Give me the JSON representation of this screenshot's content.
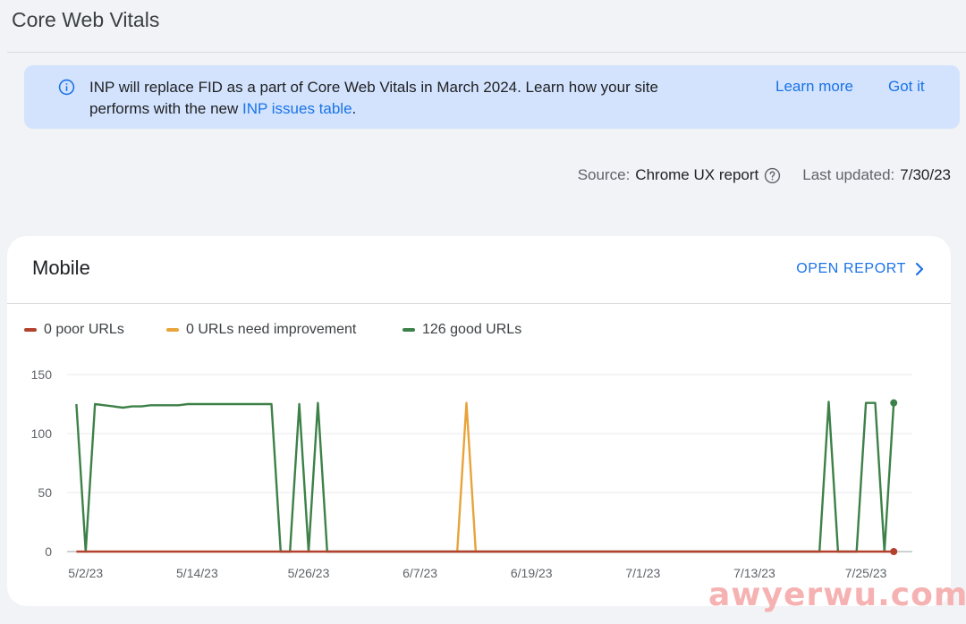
{
  "page": {
    "title": "Core Web Vitals"
  },
  "banner": {
    "icon": "info-icon",
    "text_before": "INP will replace FID as a part of Core Web Vitals in March 2024. Learn how your site performs with the new ",
    "link_text": "INP issues table",
    "text_after": ".",
    "learn_more": "Learn more",
    "got_it": "Got it"
  },
  "meta": {
    "source_label": "Source:",
    "source_value": "Chrome UX report",
    "help_icon": "help-circle-icon",
    "updated_label": "Last updated:",
    "updated_value": "7/30/23"
  },
  "card": {
    "title": "Mobile",
    "open_report": "OPEN REPORT",
    "open_icon": "chevron-right-icon"
  },
  "legend": [
    {
      "label": "0 poor URLs",
      "color": "#b3412d"
    },
    {
      "label": "0 URLs need improvement",
      "color": "#e8a33a"
    },
    {
      "label": "126 good URLs",
      "color": "#3d8148"
    }
  ],
  "chart_data": {
    "type": "line",
    "y_ticks": [
      "150",
      "100",
      "50",
      "0"
    ],
    "ylim": [
      0,
      150
    ],
    "x_ticks": [
      "5/2/23",
      "5/14/23",
      "5/26/23",
      "6/7/23",
      "6/19/23",
      "7/1/23",
      "7/13/23",
      "7/25/23"
    ],
    "x_start": "5/1/23",
    "x_end": "7/30/23",
    "series": [
      {
        "name": "good URLs",
        "color": "#3d8148",
        "points": [
          [
            "5/1/23",
            125
          ],
          [
            "5/2/23",
            0
          ],
          [
            "5/3/23",
            125
          ],
          [
            "5/4/23",
            124
          ],
          [
            "5/5/23",
            123
          ],
          [
            "5/6/23",
            122
          ],
          [
            "5/7/23",
            123
          ],
          [
            "5/8/23",
            123
          ],
          [
            "5/9/23",
            124
          ],
          [
            "5/10/23",
            124
          ],
          [
            "5/11/23",
            124
          ],
          [
            "5/12/23",
            124
          ],
          [
            "5/13/23",
            125
          ],
          [
            "5/14/23",
            125
          ],
          [
            "5/15/23",
            125
          ],
          [
            "5/16/23",
            125
          ],
          [
            "5/17/23",
            125
          ],
          [
            "5/18/23",
            125
          ],
          [
            "5/19/23",
            125
          ],
          [
            "5/20/23",
            125
          ],
          [
            "5/21/23",
            125
          ],
          [
            "5/22/23",
            125
          ],
          [
            "5/23/23",
            0
          ],
          [
            "5/24/23",
            0
          ],
          [
            "5/25/23",
            125
          ],
          [
            "5/26/23",
            0
          ],
          [
            "5/27/23",
            126
          ],
          [
            "5/28/23",
            0
          ],
          [
            "5/29/23",
            0
          ],
          [
            "7/20/23",
            0
          ],
          [
            "7/21/23",
            127
          ],
          [
            "7/22/23",
            0
          ],
          [
            "7/23/23",
            0
          ],
          [
            "7/24/23",
            0
          ],
          [
            "7/25/23",
            126
          ],
          [
            "7/26/23",
            126
          ],
          [
            "7/27/23",
            0
          ],
          [
            "7/28/23",
            126
          ]
        ]
      },
      {
        "name": "URLs need improvement",
        "color": "#e8a33a",
        "points": [
          [
            "6/11/23",
            0
          ],
          [
            "6/12/23",
            126
          ],
          [
            "6/13/23",
            0
          ]
        ]
      },
      {
        "name": "poor URLs",
        "color": "#b3412d",
        "points": [
          [
            "5/1/23",
            0
          ],
          [
            "7/28/23",
            0
          ]
        ]
      }
    ]
  },
  "watermark": "awyerwu.com"
}
